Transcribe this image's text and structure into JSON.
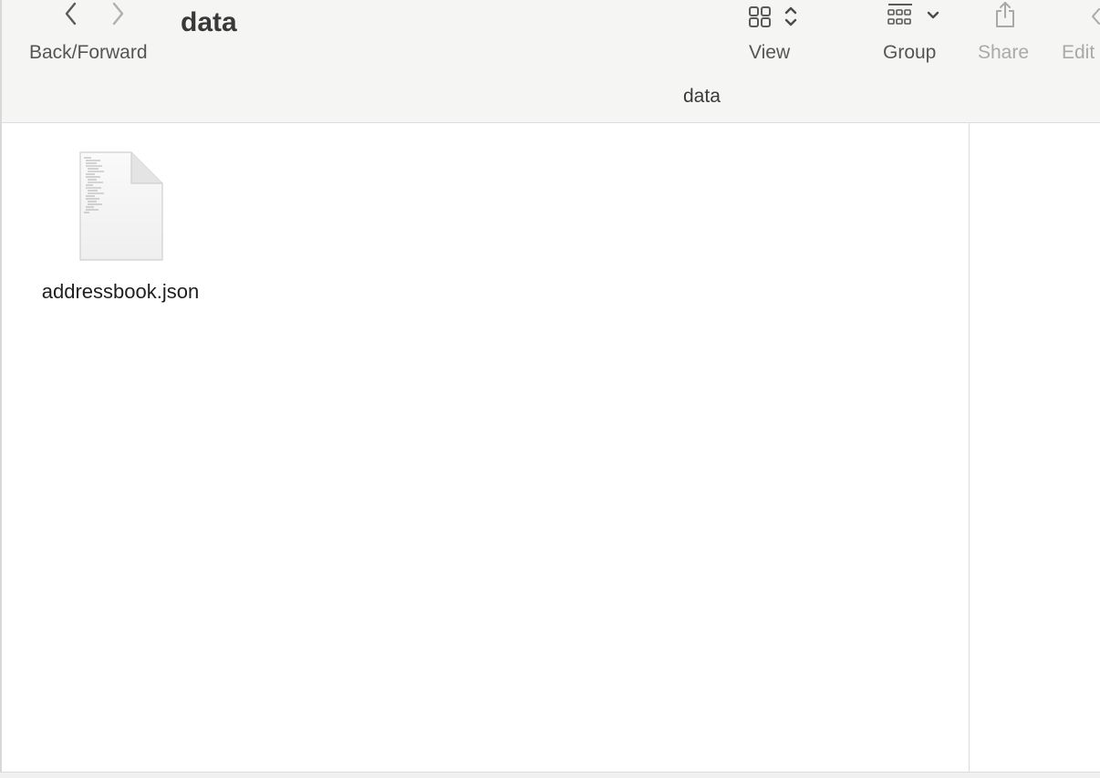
{
  "toolbar": {
    "back_forward_label": "Back/Forward",
    "window_title": "data",
    "view_label": "View",
    "group_label": "Group",
    "share_label": "Share",
    "edit_label": "Edit",
    "path_title": "data",
    "icons": {
      "back": "chevron-left-icon",
      "forward": "chevron-right-icon",
      "view": "icon-grid-icon",
      "group": "group-icon",
      "share": "share-icon",
      "edit": "edit-icon"
    }
  },
  "files": [
    {
      "name": "addressbook.json",
      "icon": "document-icon"
    }
  ],
  "colors": {
    "toolbar_bg": "#f5f5f3",
    "label": "#555555",
    "label_disabled": "#a9a9a9"
  }
}
